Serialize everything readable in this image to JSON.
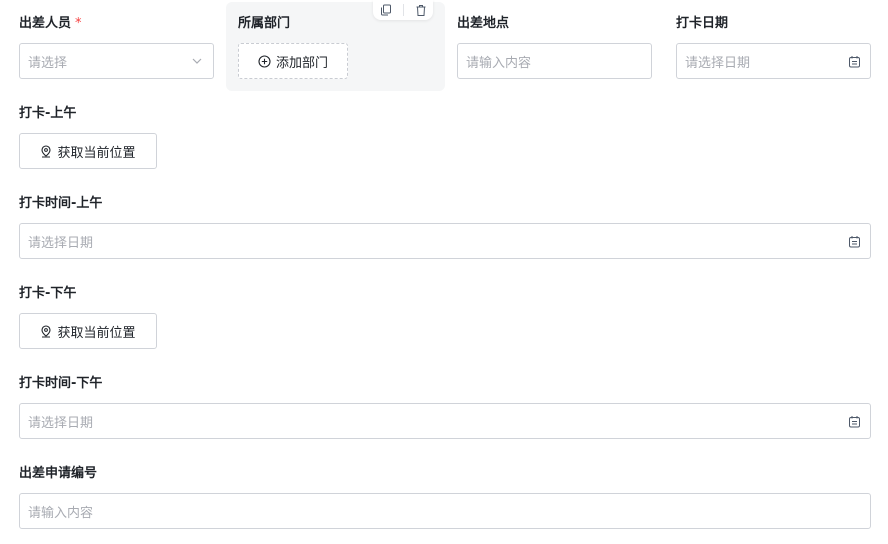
{
  "form": {
    "traveler": {
      "label": "出差人员",
      "required_mark": "*",
      "placeholder": "请选择"
    },
    "department": {
      "label": "所属部门",
      "add_button": "添加部门"
    },
    "location": {
      "label": "出差地点",
      "placeholder": "请输入内容"
    },
    "checkin_date": {
      "label": "打卡日期",
      "placeholder": "请选择日期"
    },
    "checkin_am": {
      "label": "打卡-上午",
      "button": "获取当前位置"
    },
    "checkin_time_am": {
      "label": "打卡时间-上午",
      "placeholder": "请选择日期"
    },
    "checkin_pm": {
      "label": "打卡-下午",
      "button": "获取当前位置"
    },
    "checkin_time_pm": {
      "label": "打卡时间-下午",
      "placeholder": "请选择日期"
    },
    "request_no": {
      "label": "出差申请编号",
      "placeholder": "请输入内容"
    }
  },
  "icons": {
    "copy": "copy-icon",
    "delete": "trash-icon",
    "calendar": "calendar-icon",
    "location": "map-pin-icon",
    "add": "plus-circle-icon",
    "dropdown": "chevron-down-icon"
  },
  "colors": {
    "required": "#f53f3f",
    "placeholder": "#a8abb2",
    "border": "#d0d3d9"
  }
}
